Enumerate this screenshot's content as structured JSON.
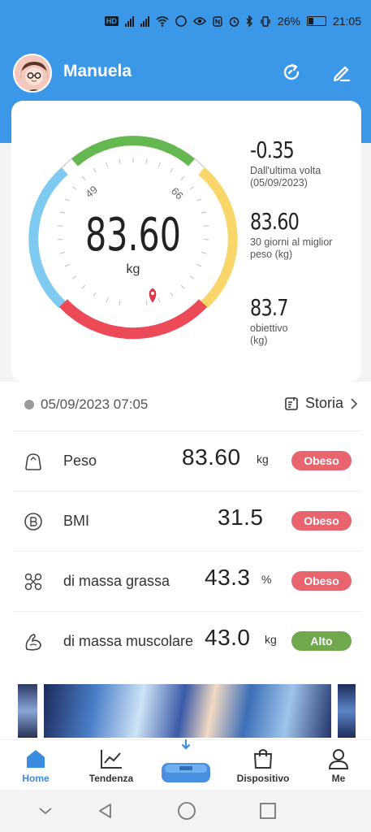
{
  "status_bar": {
    "battery": "26%",
    "time": "21:05",
    "hd_label": "HD"
  },
  "header": {
    "username": "Manuela",
    "icons": [
      "avatar",
      "sync-icon",
      "edit-icon"
    ]
  },
  "gauge": {
    "weight": "83.60",
    "unit": "kg",
    "tick_low": "49",
    "tick_high": "66",
    "colors": {
      "underweight": "#7fcaf0",
      "normal": "#65b84f",
      "overweight": "#f8d66a",
      "obese": "#ec4a57"
    }
  },
  "stats": [
    {
      "value": "-0.35",
      "label": "Dall'ultima volta (05/09/2023)"
    },
    {
      "value": "83.60",
      "label": "30 giorni al miglior peso (kg)"
    },
    {
      "value": "83.7",
      "label": "obiettivo (kg)"
    }
  ],
  "measurement": {
    "datetime": "05/09/2023 07:05",
    "history_label": "Storia"
  },
  "metrics": [
    {
      "label": "Peso",
      "value": "83.60",
      "unit": "kg",
      "status": "Obeso",
      "status_color": "#e86570",
      "icon": "weight-icon"
    },
    {
      "label": "BMI",
      "value": "31.5",
      "unit": "",
      "status": "Obeso",
      "status_color": "#e86570",
      "icon": "bmi-icon"
    },
    {
      "label": "di massa grassa",
      "value": "43.3",
      "unit": "%",
      "status": "Obeso",
      "status_color": "#e86570",
      "icon": "fat-mass-icon"
    },
    {
      "label": "di massa muscolare",
      "value": "43.0",
      "unit": "kg",
      "status": "Alto",
      "status_color": "#6fa84d",
      "icon": "muscle-icon"
    }
  ],
  "bottom_nav": [
    {
      "label": "Home",
      "icon": "home-icon",
      "active": true
    },
    {
      "label": "Tendenza",
      "icon": "trend-icon",
      "active": false
    },
    {
      "label": "",
      "icon": "scale-icon",
      "active": false
    },
    {
      "label": "Dispositivo",
      "icon": "device-bag-icon",
      "active": false
    },
    {
      "label": "Me",
      "icon": "profile-icon",
      "active": false
    }
  ],
  "accent_color": "#3b97e8"
}
